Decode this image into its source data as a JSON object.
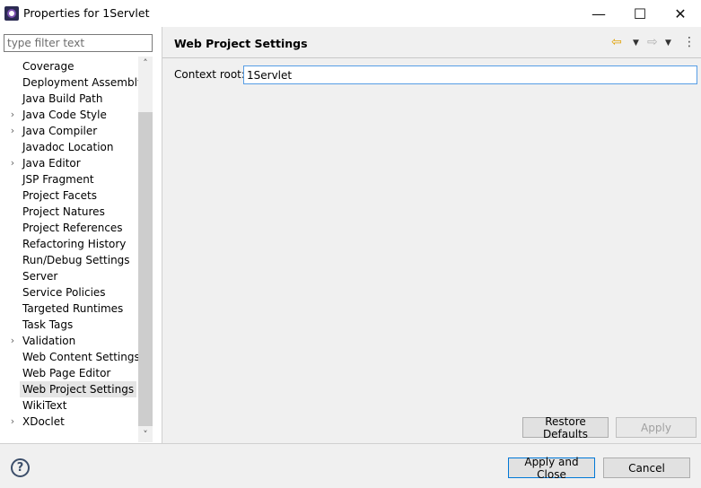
{
  "window": {
    "title": "Properties for 1Servlet",
    "minimize_glyph": "—",
    "maximize_glyph": "☐",
    "close_glyph": "✕"
  },
  "filter": {
    "placeholder": "type filter text",
    "value": ""
  },
  "tree": {
    "items": [
      {
        "label": "Coverage",
        "expandable": false
      },
      {
        "label": "Deployment Assembly",
        "expandable": false
      },
      {
        "label": "Java Build Path",
        "expandable": false
      },
      {
        "label": "Java Code Style",
        "expandable": true
      },
      {
        "label": "Java Compiler",
        "expandable": true
      },
      {
        "label": "Javadoc Location",
        "expandable": false
      },
      {
        "label": "Java Editor",
        "expandable": true
      },
      {
        "label": "JSP Fragment",
        "expandable": false
      },
      {
        "label": "Project Facets",
        "expandable": false
      },
      {
        "label": "Project Natures",
        "expandable": false
      },
      {
        "label": "Project References",
        "expandable": false
      },
      {
        "label": "Refactoring History",
        "expandable": false
      },
      {
        "label": "Run/Debug Settings",
        "expandable": false
      },
      {
        "label": "Server",
        "expandable": false
      },
      {
        "label": "Service Policies",
        "expandable": false
      },
      {
        "label": "Targeted Runtimes",
        "expandable": false
      },
      {
        "label": "Task Tags",
        "expandable": false
      },
      {
        "label": "Validation",
        "expandable": true
      },
      {
        "label": "Web Content Settings",
        "expandable": false
      },
      {
        "label": "Web Page Editor",
        "expandable": false
      },
      {
        "label": "Web Project Settings",
        "expandable": false,
        "selected": true
      },
      {
        "label": "WikiText",
        "expandable": false
      },
      {
        "label": "XDoclet",
        "expandable": true
      }
    ],
    "expander_glyph": "›",
    "scroll_up_glyph": "˄",
    "scroll_down_glyph": "˅"
  },
  "page": {
    "title": "Web Project Settings",
    "context_root_label": "Context root:",
    "context_root_value": "1Servlet",
    "back_icon": "⇦",
    "forward_icon": "⇨",
    "dropdown_glyph": "▼",
    "menu_icon": "⋮",
    "restore_defaults": "Restore Defaults",
    "apply": "Apply"
  },
  "footer": {
    "help_glyph": "?",
    "apply_and_close": "Apply and Close",
    "cancel": "Cancel"
  },
  "colors": {
    "selection": "#e5e5e5",
    "focus_border": "#0078d7",
    "back_arrow": "#e0a000"
  }
}
